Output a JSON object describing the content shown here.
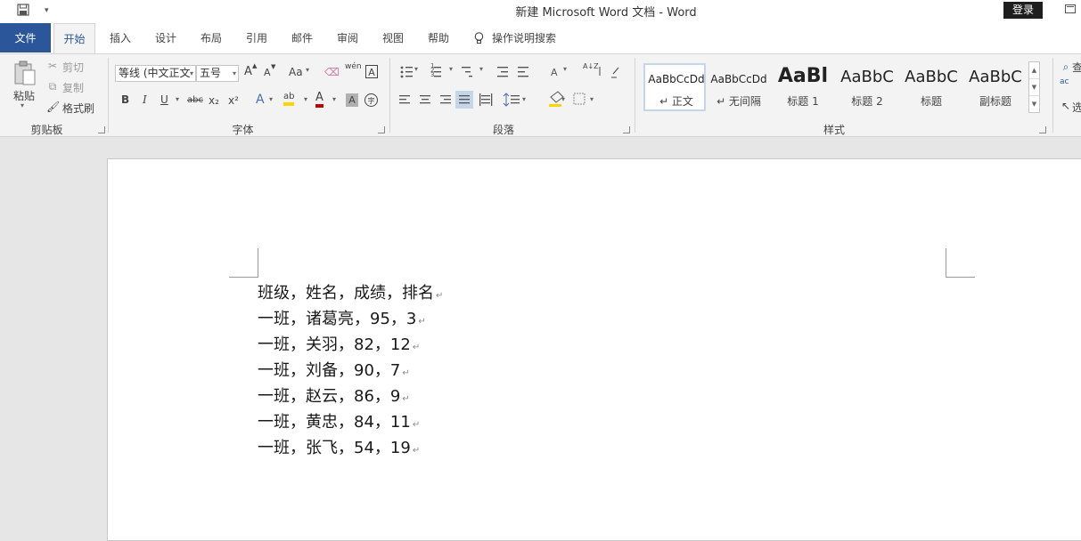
{
  "window": {
    "title": "新建 Microsoft Word 文档  -  Word",
    "login_label": "登录"
  },
  "tabs": [
    {
      "label": "文件"
    },
    {
      "label": "开始"
    },
    {
      "label": "插入"
    },
    {
      "label": "设计"
    },
    {
      "label": "布局"
    },
    {
      "label": "引用"
    },
    {
      "label": "邮件"
    },
    {
      "label": "审阅"
    },
    {
      "label": "视图"
    },
    {
      "label": "帮助"
    }
  ],
  "tell_me": {
    "label": "操作说明搜索"
  },
  "clipboard": {
    "paste_label": "粘贴",
    "cut_label": "剪切",
    "copy_label": "复制",
    "format_painter_label": "格式刷",
    "group_label": "剪贴板"
  },
  "font": {
    "font_name": "等线 (中文正文",
    "font_size": "五号",
    "grow_label": "A",
    "shrink_label": "A",
    "case_label": "Aa",
    "phonetic_label": "wén",
    "border_label": "A",
    "bold_label": "B",
    "italic_label": "I",
    "underline_label": "U",
    "strike_label": "abc",
    "subscript_label": "x₂",
    "superscript_label": "x²",
    "effects_label": "A",
    "highlight_label": "ab",
    "color_label": "A",
    "shade_label": "A",
    "enclose_label": "字",
    "group_label": "字体"
  },
  "paragraph": {
    "sort_label": "A↓Z",
    "group_label": "段落"
  },
  "styles": {
    "items": [
      {
        "sample": "AaBbCcDd",
        "name": "↵ 正文"
      },
      {
        "sample": "AaBbCcDd",
        "name": "↵ 无间隔"
      },
      {
        "sample": "AaBl",
        "name": "标题 1"
      },
      {
        "sample": "AaBbC",
        "name": "标题 2"
      },
      {
        "sample": "AaBbC",
        "name": "标题"
      },
      {
        "sample": "AaBbC",
        "name": "副标题"
      }
    ],
    "group_label": "样式"
  },
  "editing": {
    "find_label": "查",
    "replace_label": "ac",
    "select_label": "选"
  },
  "document": {
    "lines": [
      "班级，姓名，成绩，排名",
      "一班，诸葛亮，95，3",
      "一班，关羽，82，12",
      "一班，刘备，90，7",
      "一班，赵云，86，9",
      "一班，黄忠，84，11",
      "一班，张飞，54，19"
    ],
    "paragraph_mark": "↵"
  },
  "colors": {
    "file_tab": "#2b579a",
    "highlight": "#ffd400",
    "font_color": "#c00000"
  }
}
